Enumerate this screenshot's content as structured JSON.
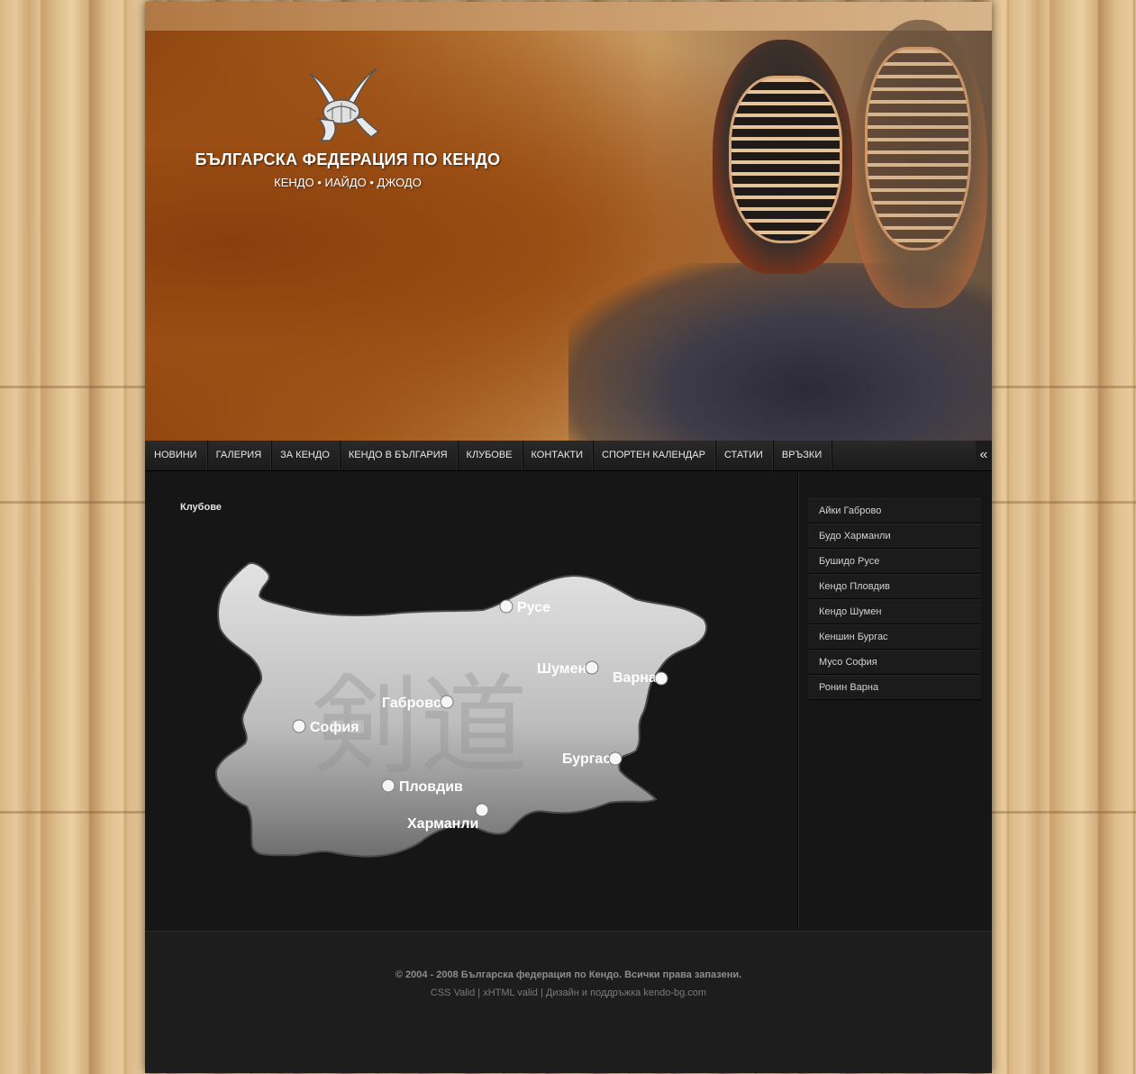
{
  "header": {
    "title": "БЪЛГАРСКА ФЕДЕРАЦИЯ ПО КЕНДО",
    "subtitle": "КЕНДО • ИАЙДО • ДЖОДО",
    "logo_icon": "kabuto-helmet-icon"
  },
  "nav": {
    "items": [
      "НОВИНИ",
      "ГАЛЕРИЯ",
      "ЗА КЕНДО",
      "КЕНДО В БЪЛГАРИЯ",
      "КЛУБОВЕ",
      "КОНТАКТИ",
      "СПОРТЕН КАЛЕНДАР",
      "СТАТИИ",
      "ВРЪЗКИ"
    ],
    "collapse_icon": "«"
  },
  "content": {
    "breadcrumb": "Клубове",
    "map": {
      "watermark": "剣道",
      "cities": [
        "Русе",
        "Шумен",
        "Варна",
        "Габрово",
        "София",
        "Бургас",
        "Пловдив",
        "Харманли"
      ]
    }
  },
  "sidebar": {
    "clubs": [
      "Айки Габрово",
      "Будо Харманли",
      "Бушидо Русе",
      "Кендо Пловдив",
      "Кендо Шумен",
      "Кеншин Бургас",
      "Мусо София",
      "Ронин Варна"
    ]
  },
  "footer": {
    "copyright": "© 2004 - 2008 Българска федерация по Кендо. Всички права запазени.",
    "links": "CSS Valid | xHTML valid | Дизайн и поддръжка kendo-bg.com"
  },
  "colors": {
    "page_bg": "#161616",
    "header_orange": "#9a4e14",
    "wood": "#dcbc8a"
  }
}
